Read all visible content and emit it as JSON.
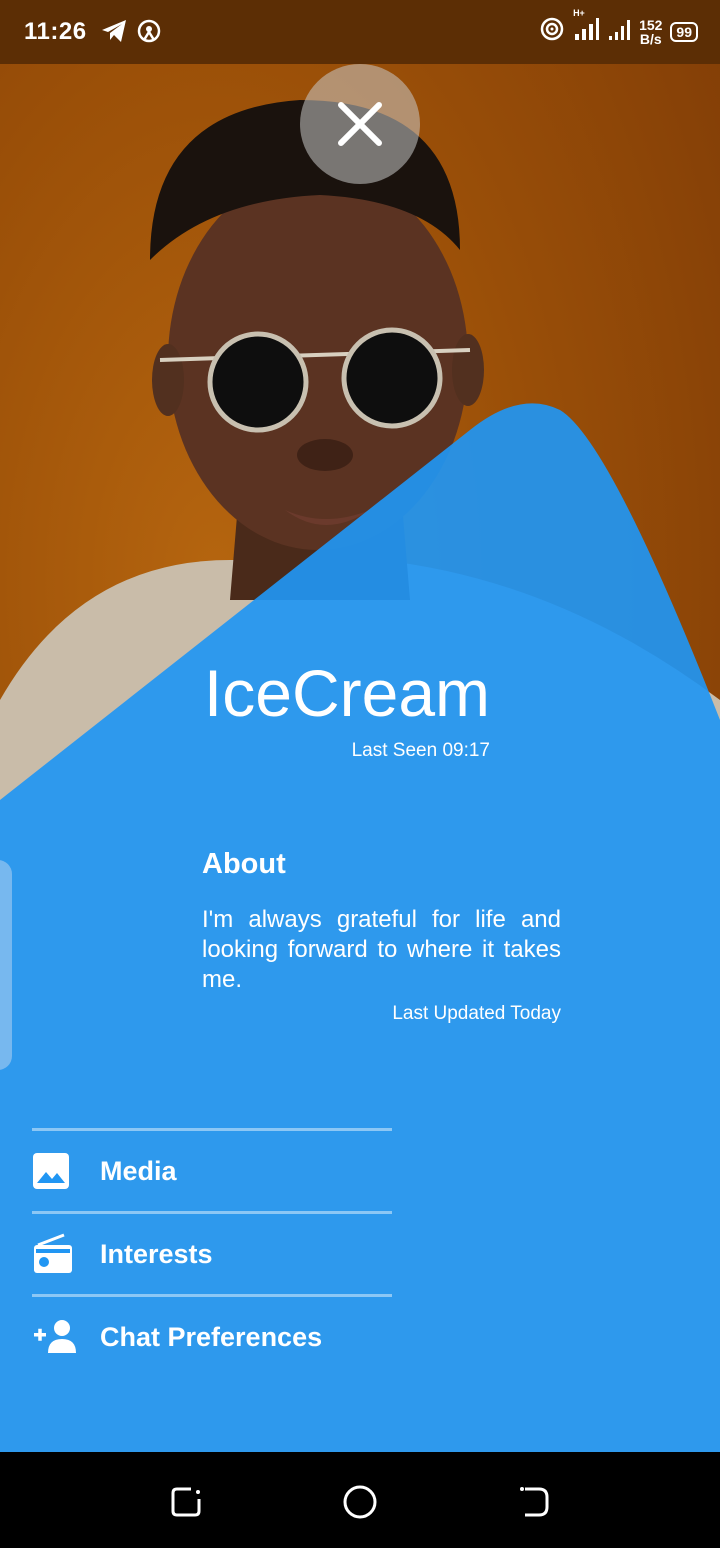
{
  "status_bar": {
    "time": "11:26",
    "network_type": "H+",
    "speed_value": "152",
    "speed_unit": "B/s",
    "battery": "99",
    "icons": [
      "telegram-icon",
      "hotspot-icon",
      "wifi-icon",
      "signal-icon",
      "signal-icon"
    ]
  },
  "profile": {
    "name": "IceCream",
    "last_seen": "Last Seen 09:17",
    "about_title": "About",
    "about_text": "I'm always grateful for life and looking forward to where it takes me.",
    "last_updated": "Last Updated Today"
  },
  "menu": {
    "items": [
      {
        "label": "Media",
        "icon": "image-icon"
      },
      {
        "label": "Interests",
        "icon": "radio-icon"
      },
      {
        "label": "Chat Preferences",
        "icon": "add-person-icon"
      }
    ]
  },
  "colors": {
    "accent_blue": "#2196f3",
    "photo_orange": "#9a4f08",
    "status_bar": "#5c2e05"
  },
  "nav": {
    "icons": [
      "recent-apps-icon",
      "home-icon",
      "back-icon"
    ]
  }
}
